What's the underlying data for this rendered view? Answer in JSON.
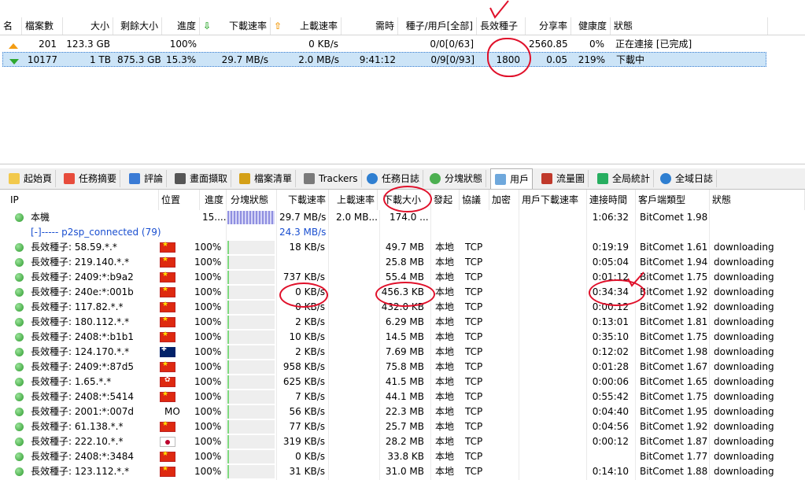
{
  "colors": {
    "annotation": "#e0102a",
    "selected_row": "#cce4f7",
    "link": "#1a4fd0"
  },
  "task_table": {
    "headers": [
      "名",
      "檔案數",
      "大小",
      "剩餘大小",
      "進度",
      "下載速率",
      "上載速率",
      "需時",
      "種子/用戶[全部]",
      "長效種子",
      "分享率",
      "健康度",
      "狀態"
    ],
    "rows": [
      {
        "icon": "upload-arrow-icon",
        "files": "201",
        "size": "123.3 GB",
        "remaining": "",
        "progress": "100%",
        "down": "",
        "up": "0 KB/s",
        "eta": "",
        "seeds": "0/0[0/63]",
        "longseed": "",
        "share": "2560.85",
        "health": "0%",
        "status": "正在連接 [已完成]"
      },
      {
        "icon": "download-arrow-icon",
        "files": "10177",
        "size": "1 TB",
        "remaining": "875.3 GB",
        "progress": "15.3%",
        "down": "29.7 MB/s",
        "up": "2.0 MB/s",
        "eta": "9:41:12",
        "seeds": "0/9[0/93]",
        "longseed": "1800",
        "share": "0.05",
        "health": "219%",
        "status": "下載中"
      }
    ]
  },
  "tabs": [
    "起始頁",
    "任務摘要",
    "評論",
    "畫面擷取",
    "檔案清單",
    "Trackers",
    "任務日誌",
    "分塊狀態",
    "用戶",
    "流量圖",
    "全局統計",
    "全域日誌"
  ],
  "peer_table": {
    "headers": [
      "IP",
      "位置",
      "進度",
      "分塊狀態",
      "下載速率",
      "上載速率",
      "下載大小",
      "發起",
      "協議",
      "加密",
      "用戶下載速率",
      "連接時間",
      "客戶端類型",
      "狀態"
    ],
    "local": {
      "ip": "本機",
      "progress": "15....",
      "down": "29.7 MB/s",
      "up": "2.0 MB...",
      "size": "174.0 ...",
      "time": "1:06:32",
      "client": "BitComet 1.98"
    },
    "group": {
      "label": "[-]----- p2sp_connected (79)",
      "down": "24.3 MB/s"
    },
    "rows": [
      {
        "ip": "長效種子: 58.59.*.*",
        "loc": "cn",
        "progress": "100%",
        "down": "18 KB/s",
        "size": "49.7 MB",
        "init": "本地",
        "proto": "TCP",
        "time": "0:19:19",
        "client": "BitComet 1.61",
        "status": "downloading"
      },
      {
        "ip": "長效種子: 219.140.*.*",
        "loc": "cn",
        "progress": "100%",
        "down": "",
        "size": "25.8 MB",
        "init": "本地",
        "proto": "TCP",
        "time": "0:05:04",
        "client": "BitComet 1.94",
        "status": "downloading"
      },
      {
        "ip": "長效種子: 2409:*:b9a2",
        "loc": "cn",
        "progress": "100%",
        "down": "737 KB/s",
        "size": "55.4 MB",
        "init": "本地",
        "proto": "TCP",
        "time": "0:01:12",
        "client": "BitComet 1.75",
        "status": "downloading"
      },
      {
        "ip": "長效種子: 240e:*:001b",
        "loc": "cn",
        "progress": "100%",
        "down": "0 KB/s",
        "size": "456.3 KB",
        "init": "本地",
        "proto": "TCP",
        "time": "0:34:34",
        "client": "BitComet 1.92",
        "status": "downloading"
      },
      {
        "ip": "長效種子: 117.82.*.*",
        "loc": "cn",
        "progress": "100%",
        "down": "0 KB/s",
        "size": "432.0 KB",
        "init": "本地",
        "proto": "TCP",
        "time": "0:00:12",
        "client": "BitComet 1.92",
        "status": "downloading"
      },
      {
        "ip": "長效種子: 180.112.*.*",
        "loc": "cn",
        "progress": "100%",
        "down": "2 KB/s",
        "size": "6.29 MB",
        "init": "本地",
        "proto": "TCP",
        "time": "0:13:01",
        "client": "BitComet 1.81",
        "status": "downloading"
      },
      {
        "ip": "長效種子: 2408:*:b1b1",
        "loc": "cn",
        "progress": "100%",
        "down": "10 KB/s",
        "size": "14.5 MB",
        "init": "本地",
        "proto": "TCP",
        "time": "0:35:10",
        "client": "BitComet 1.75",
        "status": "downloading"
      },
      {
        "ip": "長效種子: 124.170.*.*",
        "loc": "au",
        "progress": "100%",
        "down": "2 KB/s",
        "size": "7.69 MB",
        "init": "本地",
        "proto": "TCP",
        "time": "0:12:02",
        "client": "BitComet 1.98",
        "status": "downloading"
      },
      {
        "ip": "長效種子: 2409:*:87d5",
        "loc": "cn",
        "progress": "100%",
        "down": "958 KB/s",
        "size": "75.8 MB",
        "init": "本地",
        "proto": "TCP",
        "time": "0:01:28",
        "client": "BitComet 1.67",
        "status": "downloading"
      },
      {
        "ip": "長效種子: 1.65.*.*",
        "loc": "hk",
        "progress": "100%",
        "down": "625 KB/s",
        "size": "41.5 MB",
        "init": "本地",
        "proto": "TCP",
        "time": "0:00:06",
        "client": "BitComet 1.65",
        "status": "downloading"
      },
      {
        "ip": "長效種子: 2408:*:5414",
        "loc": "cn",
        "progress": "100%",
        "down": "7 KB/s",
        "size": "44.1 MB",
        "init": "本地",
        "proto": "TCP",
        "time": "0:55:42",
        "client": "BitComet 1.75",
        "status": "downloading"
      },
      {
        "ip": "長效種子: 2001:*:007d",
        "loc": "MO",
        "progress": "100%",
        "down": "56 KB/s",
        "size": "22.3 MB",
        "init": "本地",
        "proto": "TCP",
        "time": "0:04:40",
        "client": "BitComet 1.95",
        "status": "downloading"
      },
      {
        "ip": "長效種子: 61.138.*.*",
        "loc": "cn",
        "progress": "100%",
        "down": "77 KB/s",
        "size": "25.7 MB",
        "init": "本地",
        "proto": "TCP",
        "time": "0:04:56",
        "client": "BitComet 1.92",
        "status": "downloading"
      },
      {
        "ip": "長效種子: 222.10.*.*",
        "loc": "jp",
        "progress": "100%",
        "down": "319 KB/s",
        "size": "28.2 MB",
        "init": "本地",
        "proto": "TCP",
        "time": "0:00:12",
        "client": "BitComet 1.87",
        "status": "downloading"
      },
      {
        "ip": "長效種子: 2408:*:3484",
        "loc": "cn",
        "progress": "100%",
        "down": "0 KB/s",
        "size": "33.8 KB",
        "init": "本地",
        "proto": "TCP",
        "time": "",
        "client": "BitComet 1.77",
        "status": "downloading"
      },
      {
        "ip": "長效種子: 123.112.*.*",
        "loc": "cn",
        "progress": "100%",
        "down": "31 KB/s",
        "size": "31.0 MB",
        "init": "本地",
        "proto": "TCP",
        "time": "0:14:10",
        "client": "BitComet 1.88",
        "status": "downloading"
      }
    ]
  }
}
